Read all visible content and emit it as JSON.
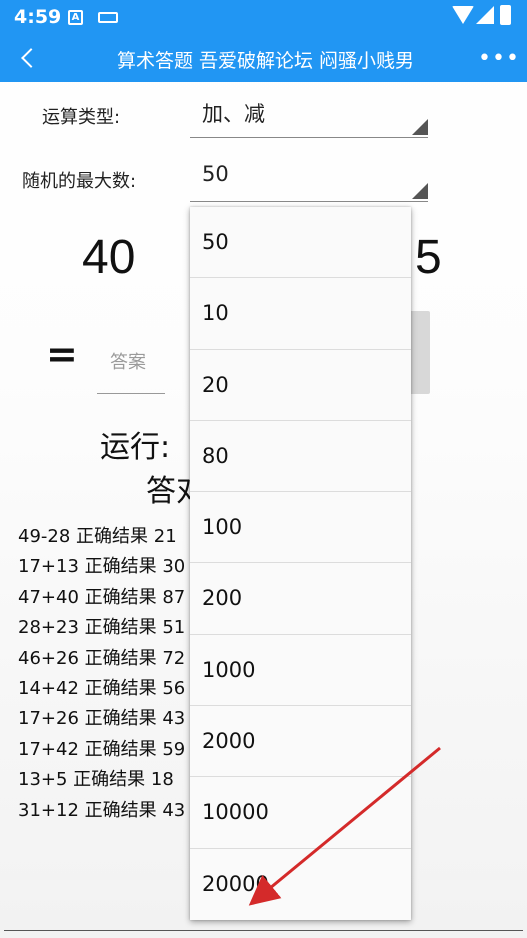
{
  "status_bar": {
    "time": "4:59",
    "notif_letter": "A"
  },
  "app_bar": {
    "title": "算术答题 吾爱破解论坛 闷骚小贱男"
  },
  "form": {
    "op_label": "运算类型:",
    "op_value": "加、减",
    "max_label": "随机的最大数:",
    "max_value": "50"
  },
  "problem": {
    "left": "40",
    "right": "5",
    "equals": "="
  },
  "answer": {
    "placeholder": "答案"
  },
  "run_label": "运行:",
  "answer_label": "答对",
  "history": [
    "49-28  正确结果 21",
    "17+13  正确结果 30",
    "47+40  正确结果 87",
    "28+23  正确结果 51",
    "46+26  正确结果 72",
    "14+42  正确结果 56",
    "17+26  正确结果 43",
    "17+42  正确结果 59",
    "13+5  正确结果 18",
    "31+12  正确结果 43"
  ],
  "dropdown_options": [
    "50",
    "10",
    "20",
    "80",
    "100",
    "200",
    "1000",
    "2000",
    "10000",
    "20000"
  ],
  "colors": {
    "app_bar": "#2196f3",
    "annotation_arrow": "#d42a2a"
  }
}
